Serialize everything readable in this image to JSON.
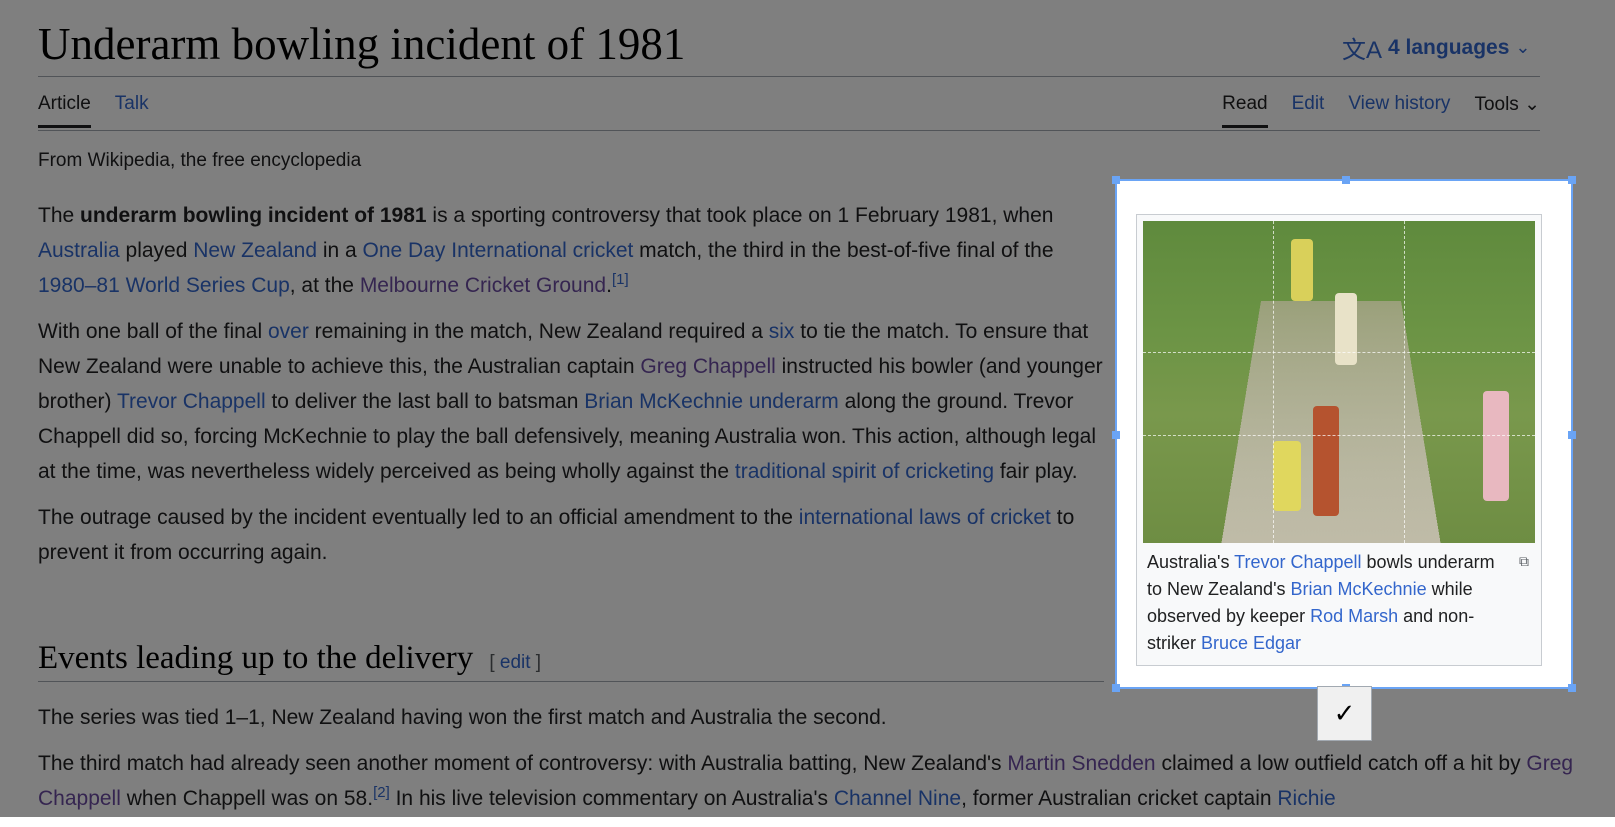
{
  "page": {
    "title": "Underarm bowling incident of 1981",
    "languages": "4 languages",
    "tagline": "From Wikipedia, the free encyclopedia"
  },
  "tabs": {
    "left": [
      "Article",
      "Talk"
    ],
    "right": [
      "Read",
      "Edit",
      "View history",
      "Tools"
    ]
  },
  "paragraphs": {
    "p1": {
      "t1": "The ",
      "bold": "underarm bowling incident of 1981",
      "t2": " is a sporting controversy that took place on 1 February 1981, when ",
      "l1": "Australia",
      "t3": " played ",
      "l2": "New Zealand",
      "t4": " in a ",
      "l3": "One Day International cricket",
      "t5": " match, the third in the best-of-five final of the ",
      "l4": "1980–81 World Series Cup",
      "t6": ", at the ",
      "l5": "Melbourne Cricket Ground",
      "t7": ".",
      "ref": "[1]"
    },
    "p2": {
      "t1": "With one ball of the final ",
      "l1": "over",
      "t2": " remaining in the match, New Zealand required a ",
      "l2": "six",
      "t3": " to tie the match. To ensure that New Zealand were unable to achieve this, the Australian captain ",
      "l3": "Greg Chappell",
      "t4": " instructed his bowler (and younger brother) ",
      "l4": "Trevor Chappell",
      "t5": " to deliver the last ball to batsman ",
      "l5": "Brian McKechnie",
      "t6": " ",
      "l6": "underarm",
      "t7": " along the ground. Trevor Chappell did so, forcing McKechnie to play the ball defensively, meaning Australia won. This action, although legal at the time, was nevertheless widely perceived as being wholly against the ",
      "l7": "traditional spirit of cricketing",
      "t8": " fair play."
    },
    "p3": {
      "t1": "The outrage caused by the incident eventually led to an official amendment to the ",
      "l1": "international laws of cricket",
      "t2": " to prevent it from occurring again."
    }
  },
  "section": {
    "heading": "Events leading up to the delivery",
    "edit_open": "[ ",
    "edit": "edit",
    "edit_close": " ]",
    "p4": "The series was tied 1–1, New Zealand having won the first match and Australia the second.",
    "p5": {
      "t1": "The third match had already seen another moment of controversy: with Australia batting, New Zealand's ",
      "l1": "Martin Snedden",
      "t2": " claimed a low outfield catch off a hit by ",
      "l2": "Greg Chappell",
      "t3": " when Chappell was on 58.",
      "ref": "[2]",
      "t4": " In his live television commentary on Australia's ",
      "l3": "Channel Nine",
      "t5": ", former Australian cricket captain ",
      "l4": "Richie"
    }
  },
  "figure": {
    "caption": {
      "t1": "Australia's ",
      "l1": "Trevor Chappell",
      "t2": " bowls underarm to New Zealand's ",
      "l2": "Brian McKechnie",
      "t3": " while observed by keeper ",
      "l3": "Rod Marsh",
      "t4": " and non-striker ",
      "l4": "Bruce Edgar"
    },
    "confirm_icon": "checkmark-icon"
  },
  "colors": {
    "link": "#3366cc",
    "visited_link": "#6b4ba1",
    "selection": "#6aa4f5",
    "dim_overlay": "rgba(0,0,0,0.5)"
  }
}
